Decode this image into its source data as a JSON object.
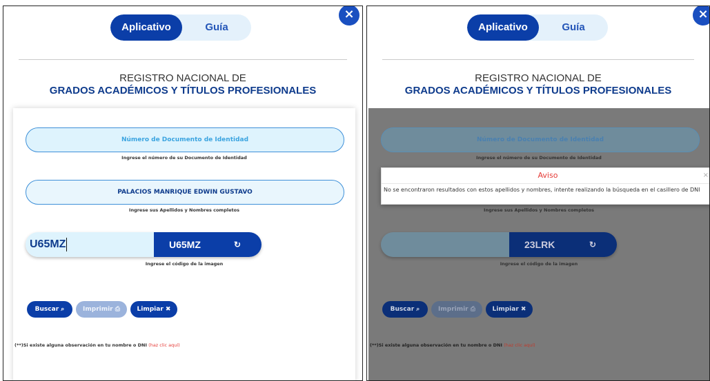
{
  "toggle": {
    "active": "Aplicativo",
    "inactive": "Guía"
  },
  "heading": {
    "line1": "REGISTRO NACIONAL DE",
    "line2": "GRADOS ACADÉMICOS Y TÍTULOS PROFESIONALES"
  },
  "form": {
    "doc_placeholder": "Número de Documento de Identidad",
    "doc_hint": "Ingrese el número de su Documento de Identidad",
    "name_value": "PALACIOS MANRIQUE EDWIN GUSTAVO",
    "name_hint": "Ingrese sus Apellidos y Nombres completos",
    "captcha_hint": "Ingrese el código de la imagen",
    "note": "(**)Si existe alguna observación en tu nombre o DNI",
    "note_link": "(haz clic aquí)"
  },
  "buttons": {
    "search": "Buscar",
    "print": "Imprimir",
    "clear": "Limpiar"
  },
  "icons": {
    "close": "×",
    "search": "⌕",
    "print": "⎙",
    "clear": "✖",
    "refresh": "↻"
  },
  "left_panel": {
    "captcha_input": "U65MZ",
    "captcha_code": "U65MZ"
  },
  "right_panel": {
    "captcha_input": "",
    "captcha_code": "23LRK"
  },
  "modal": {
    "title": "Aviso",
    "close": "×",
    "message": "No se encontraron resultados con estos apellidos y nombres, intente realizando la búsqueda en el casillero de DNI"
  }
}
